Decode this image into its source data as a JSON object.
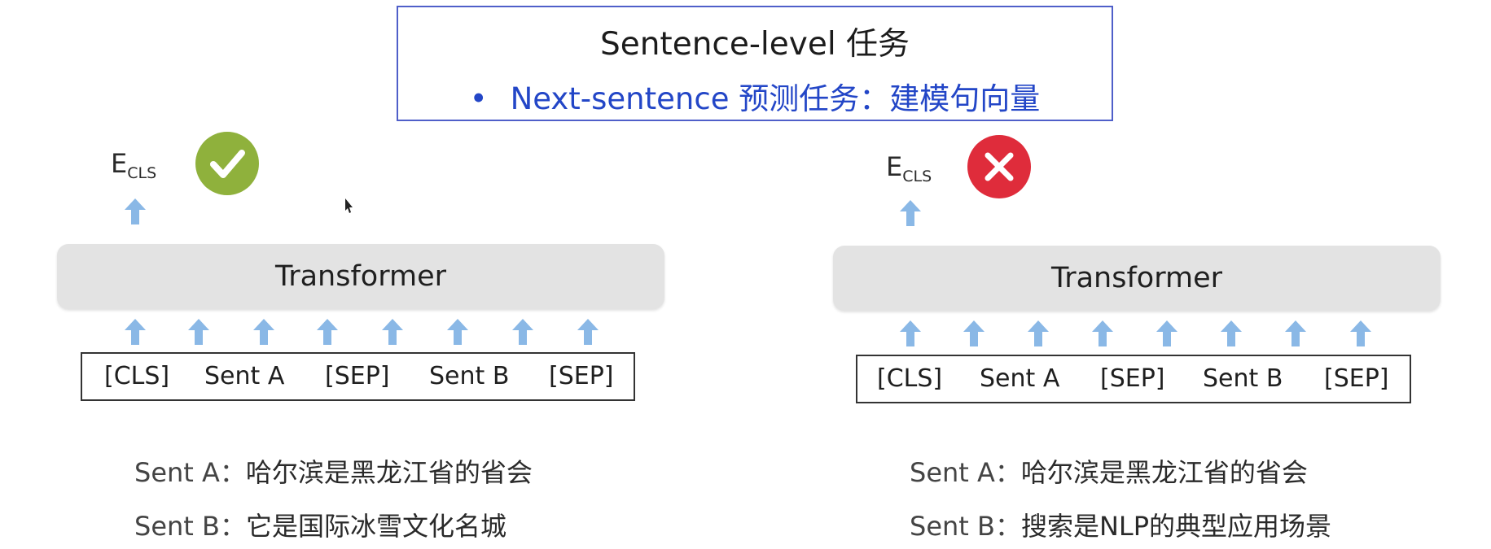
{
  "header": {
    "title": "Sentence-level 任务",
    "bullet": "•",
    "subtitle": "Next-sentence 预测任务：建模句向量"
  },
  "colors": {
    "header_border": "#4f5fc9",
    "subtitle_text": "#2346c7",
    "check_badge": "#8fb13c",
    "cross_badge": "#df2c3b",
    "arrow_fill": "#8ab8e6",
    "transformer_fill": "#e3e3e3"
  },
  "panels": [
    {
      "id": "left",
      "output_label": "E",
      "output_sub": "CLS",
      "verdict_icon": "check-icon",
      "model_label": "Transformer",
      "tokens": [
        "[CLS]",
        "Sent A",
        "[SEP]",
        "Sent B",
        "[SEP]"
      ],
      "sent_a_label": "Sent A：",
      "sent_a_text": "哈尔滨是黑龙江省的省会",
      "sent_b_label": "Sent B：",
      "sent_b_text": "它是国际冰雪文化名城"
    },
    {
      "id": "right",
      "output_label": "E",
      "output_sub": "CLS",
      "verdict_icon": "cross-icon",
      "model_label": "Transformer",
      "tokens": [
        "[CLS]",
        "Sent A",
        "[SEP]",
        "Sent B",
        "[SEP]"
      ],
      "sent_a_label": "Sent A：",
      "sent_a_text": "哈尔滨是黑龙江省的省会",
      "sent_b_label": "Sent B：",
      "sent_b_text": "搜索是NLP的典型应用场景"
    }
  ]
}
